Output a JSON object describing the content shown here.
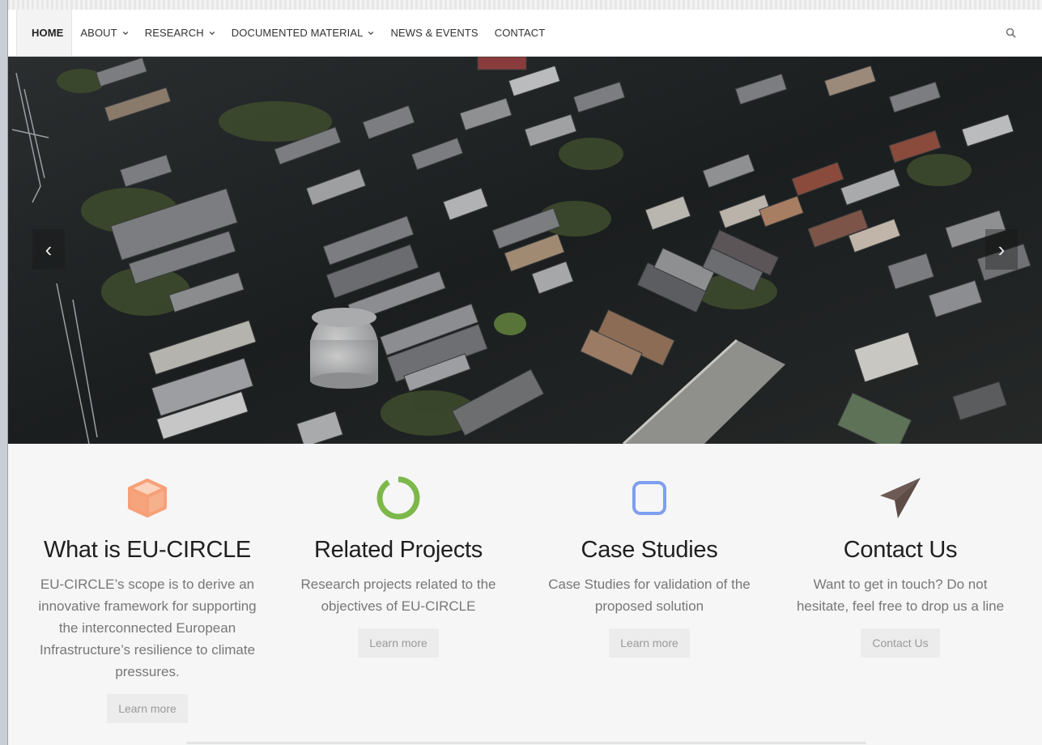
{
  "nav": {
    "items": [
      {
        "label": "HOME",
        "active": true,
        "dropdown": false
      },
      {
        "label": "ABOUT",
        "active": false,
        "dropdown": true
      },
      {
        "label": "RESEARCH",
        "active": false,
        "dropdown": true
      },
      {
        "label": "DOCUMENTED MATERIAL",
        "active": false,
        "dropdown": true
      },
      {
        "label": "NEWS & EVENTS",
        "active": false,
        "dropdown": false
      },
      {
        "label": "CONTACT",
        "active": false,
        "dropdown": false
      }
    ],
    "search_icon": "search-icon"
  },
  "hero": {
    "image": "aerial view of flooded neighborhood",
    "prev_glyph": "‹",
    "next_glyph": "›"
  },
  "features": [
    {
      "icon": "cube-icon",
      "icon_color": "#f5a57e",
      "title": "What is EU-CIRCLE",
      "text": "EU-CIRCLE’s scope is to derive an innovative framework for supporting the interconnected European Infrastructure’s resilience to climate pressures.",
      "button": "Learn more"
    },
    {
      "icon": "circle-notch-icon",
      "icon_color": "#7cb84a",
      "title": "Related Projects",
      "text": "Research projects related to the objectives of EU-CIRCLE",
      "button": "Learn more"
    },
    {
      "icon": "square-outline-icon",
      "icon_color": "#7e9ef0",
      "title": "Case Studies",
      "text": "Case Studies for validation of the proposed solution",
      "button": "Learn more"
    },
    {
      "icon": "paper-plane-icon",
      "icon_color": "#6d5a55",
      "title": "Contact Us",
      "text": "Want to get in touch? Do not hesitate, feel free to drop us a line",
      "button": "Contact Us"
    }
  ]
}
